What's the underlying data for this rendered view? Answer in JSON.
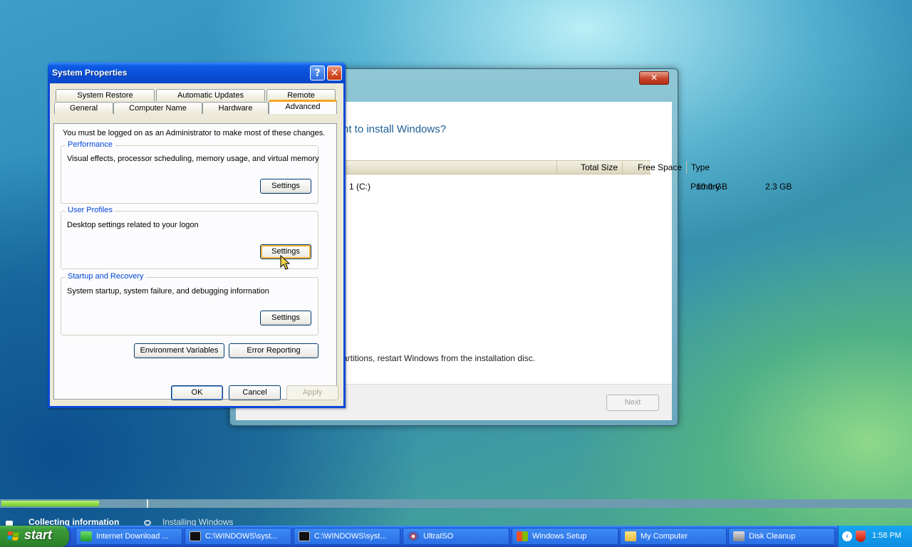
{
  "setup_window": {
    "question": "nt to install Windows?",
    "columns": [
      "Total Size",
      "Free Space",
      "Type"
    ],
    "rows": [
      {
        "name": "1 (C:)",
        "total_size": "10.0 GB",
        "free_space": "2.3 GB",
        "type": "Primary"
      }
    ],
    "note": "artitions, restart Windows from the installation disc.",
    "next_label": "Next",
    "close_glyph": "✕"
  },
  "system_properties": {
    "title": "System Properties",
    "help_glyph": "?",
    "close_glyph": "✕",
    "tabs_row1": [
      "System Restore",
      "Automatic Updates",
      "Remote"
    ],
    "tabs_row2": [
      "General",
      "Computer Name",
      "Hardware",
      "Advanced"
    ],
    "selected_tab": "Advanced",
    "intro": "You must be logged on as an Administrator to make most of these changes.",
    "groups": [
      {
        "legend": "Performance",
        "description": "Visual effects, processor scheduling, memory usage, and virtual memory",
        "button": "Settings"
      },
      {
        "legend": "User Profiles",
        "description": "Desktop settings related to your logon",
        "button": "Settings"
      },
      {
        "legend": "Startup and Recovery",
        "description": "System startup, system failure, and debugging information",
        "button": "Settings"
      }
    ],
    "env_vars_label": "Environment Variables",
    "error_reporting_label": "Error Reporting",
    "ok_label": "OK",
    "cancel_label": "Cancel",
    "apply_label": "Apply"
  },
  "setup_progress": {
    "steps": [
      "Collecting information",
      "Installing Windows"
    ],
    "collecting_progress": 0.67
  },
  "taskbar": {
    "start_label": "start",
    "tasks": [
      {
        "label": "Internet Download ...",
        "icon": "download-manager-icon"
      },
      {
        "label": "C:\\WINDOWS\\syst...",
        "icon": "command-prompt-icon"
      },
      {
        "label": "C:\\WINDOWS\\syst...",
        "icon": "command-prompt-icon"
      },
      {
        "label": "UltraISO",
        "icon": "ultraiso-icon"
      },
      {
        "label": "Windows Setup",
        "icon": "windows-setup-icon"
      },
      {
        "label": "My Computer",
        "icon": "folder-icon"
      },
      {
        "label": "Disk Cleanup",
        "icon": "disk-cleanup-icon"
      }
    ],
    "clock": "1:58 PM"
  },
  "colors": {
    "xp_title_blue": "#0a4fd6",
    "dialog_face": "#ece9d8",
    "group_legend": "#0046d5",
    "selected_tab_accent": "#f5a623",
    "start_green": "#3d9a38",
    "taskbar_blue": "#245edb",
    "progress_green": "#6fc92e"
  }
}
